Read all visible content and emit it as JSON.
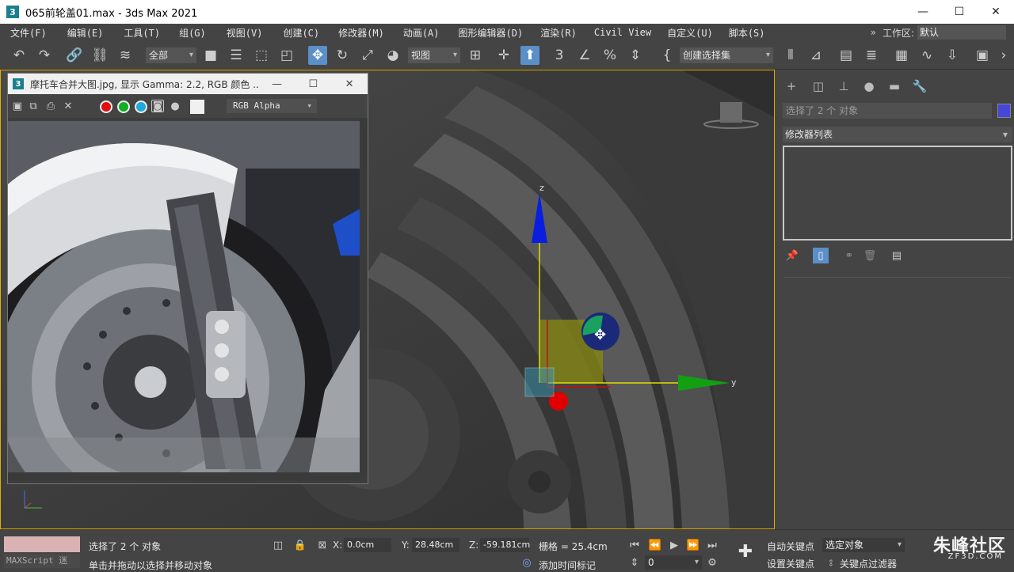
{
  "window": {
    "title": "065前轮盖01.max - 3ds Max 2021",
    "app_icon": "3"
  },
  "menu": [
    "文件(F)",
    "编辑(E)",
    "工具(T)",
    "组(G)",
    "视图(V)",
    "创建(C)",
    "修改器(M)",
    "动画(A)",
    "图形编辑器(D)",
    "渲染(R)",
    "Civil View",
    "自定义(U)",
    "脚本(S)"
  ],
  "workspace": {
    "label": "工作区:",
    "value": "默认"
  },
  "toolbar": {
    "selection_filter": "全部",
    "ref_coord": "视图",
    "named_selection": "创建选择集"
  },
  "frame_window": {
    "title": "摩托车合并大图.jpg, 显示 Gamma: 2.2, RGB 颜色 ...",
    "channel": "RGB Alpha"
  },
  "command_panel": {
    "selection_name": "选择了 2 个 对象",
    "modifier_list": "修改器列表",
    "object_color": "#4646d8"
  },
  "gizmo": {
    "z_label": "z",
    "y_label": "y"
  },
  "status": {
    "maxscript": "MAXScript 迷",
    "selection": "选择了 2 个 对象",
    "prompt": "单击并拖动以选择并移动对象",
    "x_label": "X:",
    "x_value": "0.0cm",
    "y_label": "Y:",
    "y_value": "28.48cm",
    "z_label": "Z:",
    "z_value": "-59.181cm",
    "grid": "栅格 = 25.4cm",
    "add_time_tag": "添加时间标记",
    "auto_key": "自动关键点",
    "set_key": "设置关键点",
    "key_mode": "选定对象",
    "key_filters": "关键点过滤器",
    "frame": "0"
  },
  "watermark": {
    "brand": "朱峰社区",
    "url": "ZF3D.COM"
  }
}
